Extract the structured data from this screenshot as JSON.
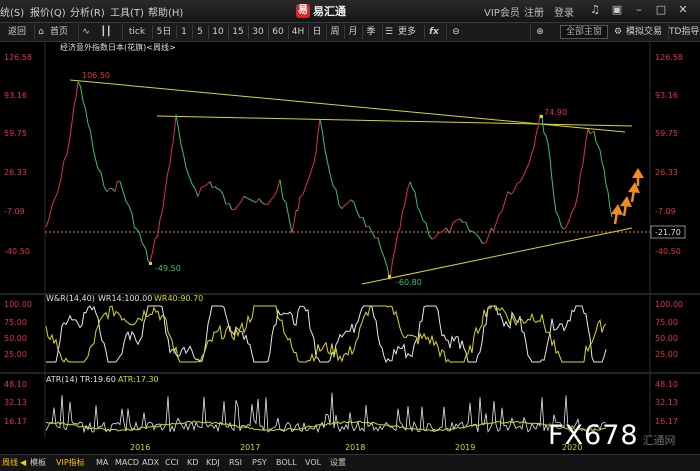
{
  "menubar": {
    "items": [
      "统(S)",
      "报价(Q)",
      "分析(R)",
      "工具(T)",
      "帮助(H)"
    ],
    "brand": "易汇通",
    "vip": "VIP会员",
    "register": "注册",
    "login": "登录"
  },
  "toolbar": {
    "back": "返回",
    "home": "首页",
    "tick": "tick",
    "periods": [
      "5日",
      "1",
      "5",
      "10",
      "15",
      "30",
      "60",
      "4H",
      "日",
      "周",
      "月",
      "季"
    ],
    "more": "更多",
    "fx": "fx",
    "layout": "全部主窗",
    "mock": "模拟交易",
    "td": "TD指导"
  },
  "chart": {
    "title": "经济意外指数日本(花旗)<周线>",
    "title_color": "#e0e0e0",
    "up_color": "#e0304a",
    "down_color": "#36c46c",
    "trend_color": "#d8d820",
    "price_axis": [
      "126.58",
      "93.16",
      "59.75",
      "26.33",
      "-7.09",
      "-40.50"
    ],
    "annotations": {
      "high": "106.50",
      "low": "-49.50",
      "low2": "-60.80",
      "peak": "74.90"
    },
    "current_value": "-21.70",
    "years": [
      "2016",
      "2017",
      "2018",
      "2019",
      "2020"
    ],
    "wr": {
      "label": "W&R(14,40)",
      "wr14": "WR14:100.00",
      "wr40": "WR40:90.70",
      "axis": [
        "100.00",
        "75.00",
        "50.00",
        "25.00"
      ],
      "axis_left": [
        "100.00",
        "75.00",
        "50.00",
        "25.00"
      ]
    },
    "atr": {
      "label": "ATR(14)",
      "tr": "TR:19.60",
      "atr": "ATR:17.30",
      "axis": [
        "48.10",
        "32.13",
        "16.17"
      ],
      "axis_left": [
        "48.10",
        "32.13",
        "16.17"
      ]
    }
  },
  "bottom": {
    "period": "周线",
    "tabs": [
      "模板",
      "VIP指标",
      "MA",
      "MACD",
      "ADX",
      "CCI",
      "KD",
      "KDJ",
      "RSI",
      "PSY",
      "BOLL",
      "VOL",
      "设置"
    ]
  },
  "watermark": {
    "main": "FX678",
    "sub": "汇通网"
  }
}
